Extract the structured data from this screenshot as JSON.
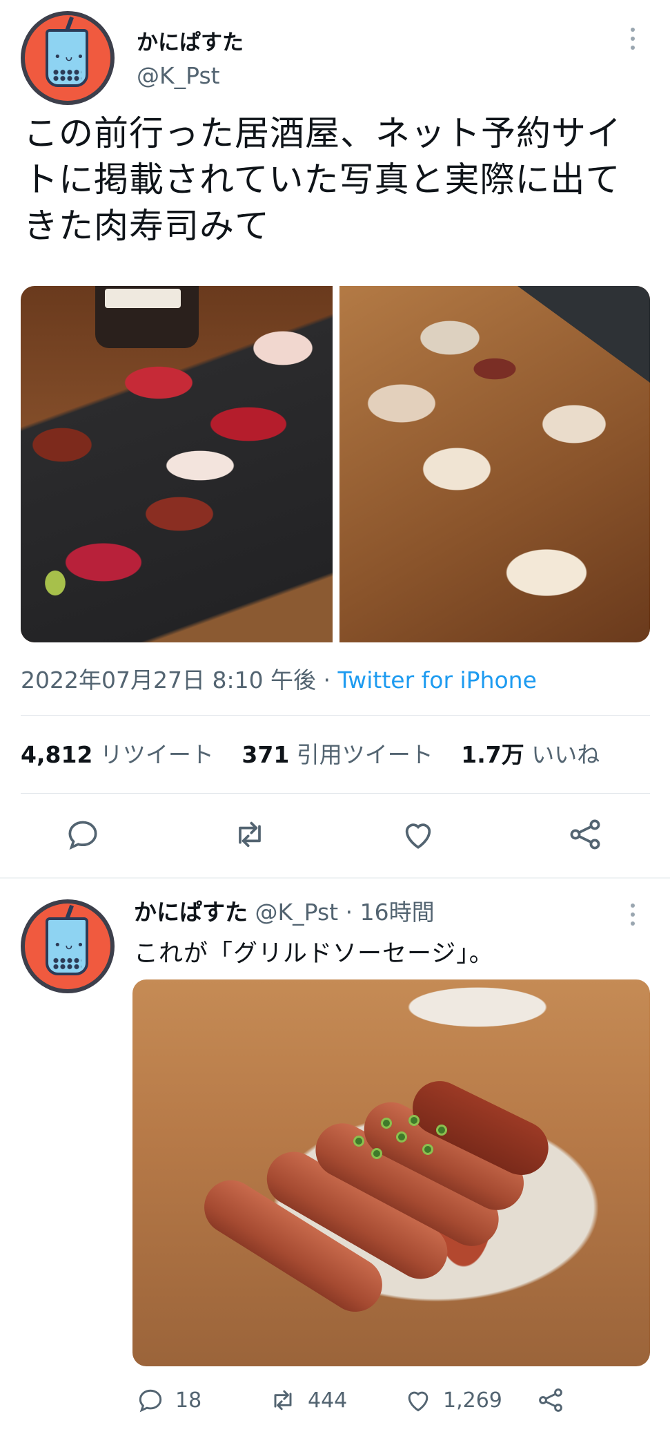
{
  "main_tweet": {
    "display_name": "かにぱすた",
    "handle": "@K_Pst",
    "text_lines": [
      "この前行った居酒屋、ネット予約サイ",
      "トに掲載されていた写真と実際に出て",
      "きた肉寿司みて"
    ],
    "timestamp": "2022年07月27日 8:10 午後",
    "separator": " · ",
    "source": "Twitter for iPhone",
    "stats": {
      "retweets_count": "4,812",
      "retweets_label": "リツイート",
      "quotes_count": "371",
      "quotes_label": "引用ツイート",
      "likes_count": "1.7万",
      "likes_label": "いいね"
    },
    "icons": [
      "reply-icon",
      "retweet-icon",
      "like-icon",
      "share-icon"
    ]
  },
  "reply_tweet": {
    "display_name": "かにぱすた",
    "handle": "@K_Pst",
    "separator": " · ",
    "time": "16時間",
    "text": "これが「グリルドソーセージ」。",
    "reply_count": "18",
    "retweet_count": "444",
    "like_count": "1,269"
  },
  "colors": {
    "text": "#0f1419",
    "secondary": "#536471",
    "link": "#1d9bf0",
    "divider": "#e1e6ea"
  }
}
